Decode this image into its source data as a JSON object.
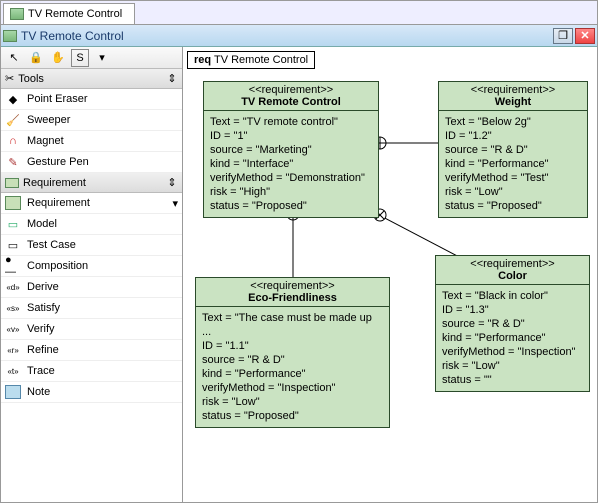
{
  "tab": {
    "label": "TV Remote Control"
  },
  "title": "TV Remote Control",
  "frame": {
    "prefix": "req",
    "name": "TV Remote Control"
  },
  "sidebar": {
    "tools_header": "Tools",
    "tools": [
      {
        "label": "Point Eraser"
      },
      {
        "label": "Sweeper"
      },
      {
        "label": "Magnet"
      },
      {
        "label": "Gesture Pen"
      }
    ],
    "req_header": "Requirement",
    "items": [
      {
        "label": "Requirement"
      },
      {
        "label": "Model"
      },
      {
        "label": "Test Case"
      },
      {
        "label": "Composition"
      },
      {
        "label": "Derive"
      },
      {
        "label": "Satisfy"
      },
      {
        "label": "Verify"
      },
      {
        "label": "Refine"
      },
      {
        "label": "Trace"
      },
      {
        "label": "Note"
      }
    ]
  },
  "toolbar": {
    "s_label": "S"
  },
  "requirements": {
    "r1": {
      "stereotype": "<<requirement>>",
      "name": "TV Remote Control",
      "fields": [
        "Text = \"TV remote control\"",
        "ID = \"1\"",
        "source = \"Marketing\"",
        "kind = \"Interface\"",
        "verifyMethod = \"Demonstration\"",
        "risk = \"High\"",
        "status = \"Proposed\""
      ]
    },
    "r2": {
      "stereotype": "<<requirement>>",
      "name": "Weight",
      "fields": [
        "Text = \"Below 2g\"",
        "ID = \"1.2\"",
        "source = \"R & D\"",
        "kind = \"Performance\"",
        "verifyMethod = \"Test\"",
        "risk = \"Low\"",
        "status = \"Proposed\""
      ]
    },
    "r3": {
      "stereotype": "<<requirement>>",
      "name": "Eco-Friendliness",
      "fields": [
        "Text = \"The case must be made up ...",
        "ID = \"1.1\"",
        "source = \"R & D\"",
        "kind = \"Performance\"",
        "verifyMethod = \"Inspection\"",
        "risk = \"Low\"",
        "status = \"Proposed\""
      ]
    },
    "r4": {
      "stereotype": "<<requirement>>",
      "name": "Color",
      "fields": [
        "Text = \"Black in color\"",
        "ID = \"1.3\"",
        "source = \"R & D\"",
        "kind = \"Performance\"",
        "verifyMethod = \"Inspection\"",
        "risk = \"Low\"",
        "status = \"\""
      ]
    }
  }
}
